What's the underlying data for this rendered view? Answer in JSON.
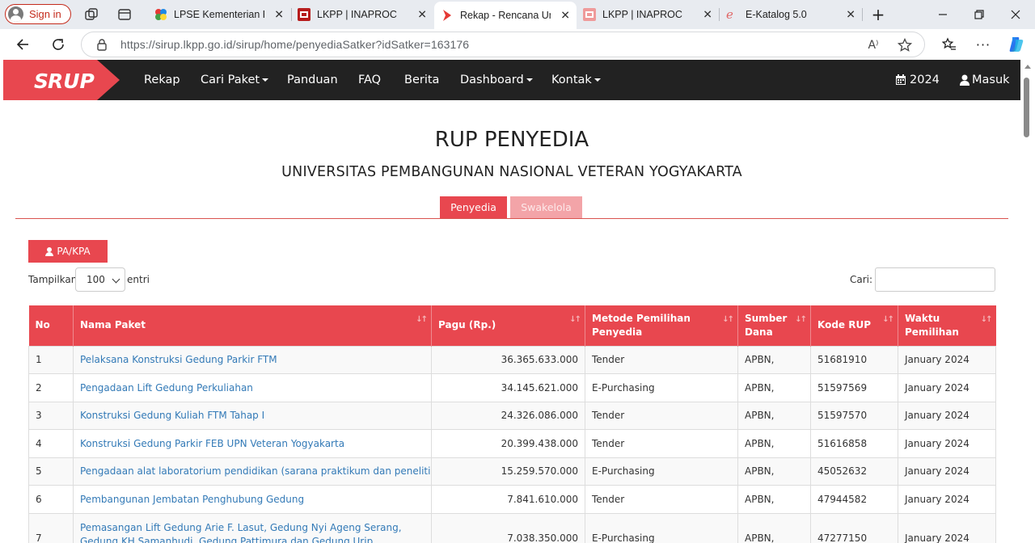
{
  "browser": {
    "signin_label": "Sign in",
    "tabs": [
      {
        "title": "LPSE Kementerian Per"
      },
      {
        "title": "LKPP | INAPROC"
      },
      {
        "title": "Rekap - Rencana Umu"
      },
      {
        "title": "LKPP | INAPROC"
      },
      {
        "title": "E-Katalog 5.0"
      }
    ],
    "url": "https://sirup.lkpp.go.id/sirup/home/penyediaSatker?idSatker=163176"
  },
  "site": {
    "logo_text": "RUP",
    "menu": [
      {
        "label": "Rekap"
      },
      {
        "label": "Cari Paket"
      },
      {
        "label": "Panduan"
      },
      {
        "label": "FAQ"
      },
      {
        "label": "Berita"
      },
      {
        "label": "Dashboard"
      },
      {
        "label": "Kontak"
      }
    ],
    "year": "2024",
    "login": "Masuk"
  },
  "main": {
    "title": "RUP PENYEDIA",
    "subtitle": "UNIVERSITAS PEMBANGUNAN NASIONAL VETERAN YOGYAKARTA",
    "tabs": [
      {
        "label": "Penyedia"
      },
      {
        "label": "Swakelola"
      }
    ],
    "pa_button": "PA/KPA",
    "show_label": "Tampilkan",
    "show_value": "100",
    "entries_label": "entri",
    "search_label": "Cari:",
    "search_value": ""
  },
  "table": {
    "headers": {
      "no": "No",
      "nama": "Nama Paket",
      "pagu": "Pagu (Rp.)",
      "metode": "Metode Pemilihan Penyedia",
      "sumber": "Sumber Dana",
      "kode": "Kode RUP",
      "waktu": "Waktu Pemilihan"
    },
    "rows": [
      {
        "no": "1",
        "nama": "Pelaksana Konstruksi Gedung Parkir FTM",
        "pagu": "36.365.633.000",
        "metode": "Tender",
        "sumber": "APBN,",
        "kode": "51681910",
        "waktu": "January 2024"
      },
      {
        "no": "2",
        "nama": "Pengadaan Lift Gedung Perkuliahan",
        "pagu": "34.145.621.000",
        "metode": "E-Purchasing",
        "sumber": "APBN,",
        "kode": "51597569",
        "waktu": "January 2024"
      },
      {
        "no": "3",
        "nama": "Konstruksi Gedung Kuliah FTM Tahap I",
        "pagu": "24.326.086.000",
        "metode": "Tender",
        "sumber": "APBN,",
        "kode": "51597570",
        "waktu": "January 2024"
      },
      {
        "no": "4",
        "nama": "Konstruksi Gedung Parkir FEB UPN Veteran Yogyakarta",
        "pagu": "20.399.438.000",
        "metode": "Tender",
        "sumber": "APBN,",
        "kode": "51616858",
        "waktu": "January 2024"
      },
      {
        "no": "5",
        "nama": "Pengadaan alat laboratorium pendidikan (sarana praktikum dan penelitian)",
        "pagu": "15.259.570.000",
        "metode": "E-Purchasing",
        "sumber": "APBN,",
        "kode": "45052632",
        "waktu": "January 2024"
      },
      {
        "no": "6",
        "nama": "Pembangunan Jembatan Penghubung Gedung",
        "pagu": "7.841.610.000",
        "metode": "Tender",
        "sumber": "APBN,",
        "kode": "47944582",
        "waktu": "January 2024"
      },
      {
        "no": "7",
        "nama": "Pemasangan Lift Gedung Arie F. Lasut, Gedung Nyi Ageng Serang, Gedung KH Samanhudi, Gedung Pattimura dan Gedung Urip Sumoharjo",
        "pagu": "7.038.350.000",
        "metode": "E-Purchasing",
        "sumber": "APBN,",
        "kode": "47277150",
        "waktu": "January 2024"
      }
    ]
  }
}
